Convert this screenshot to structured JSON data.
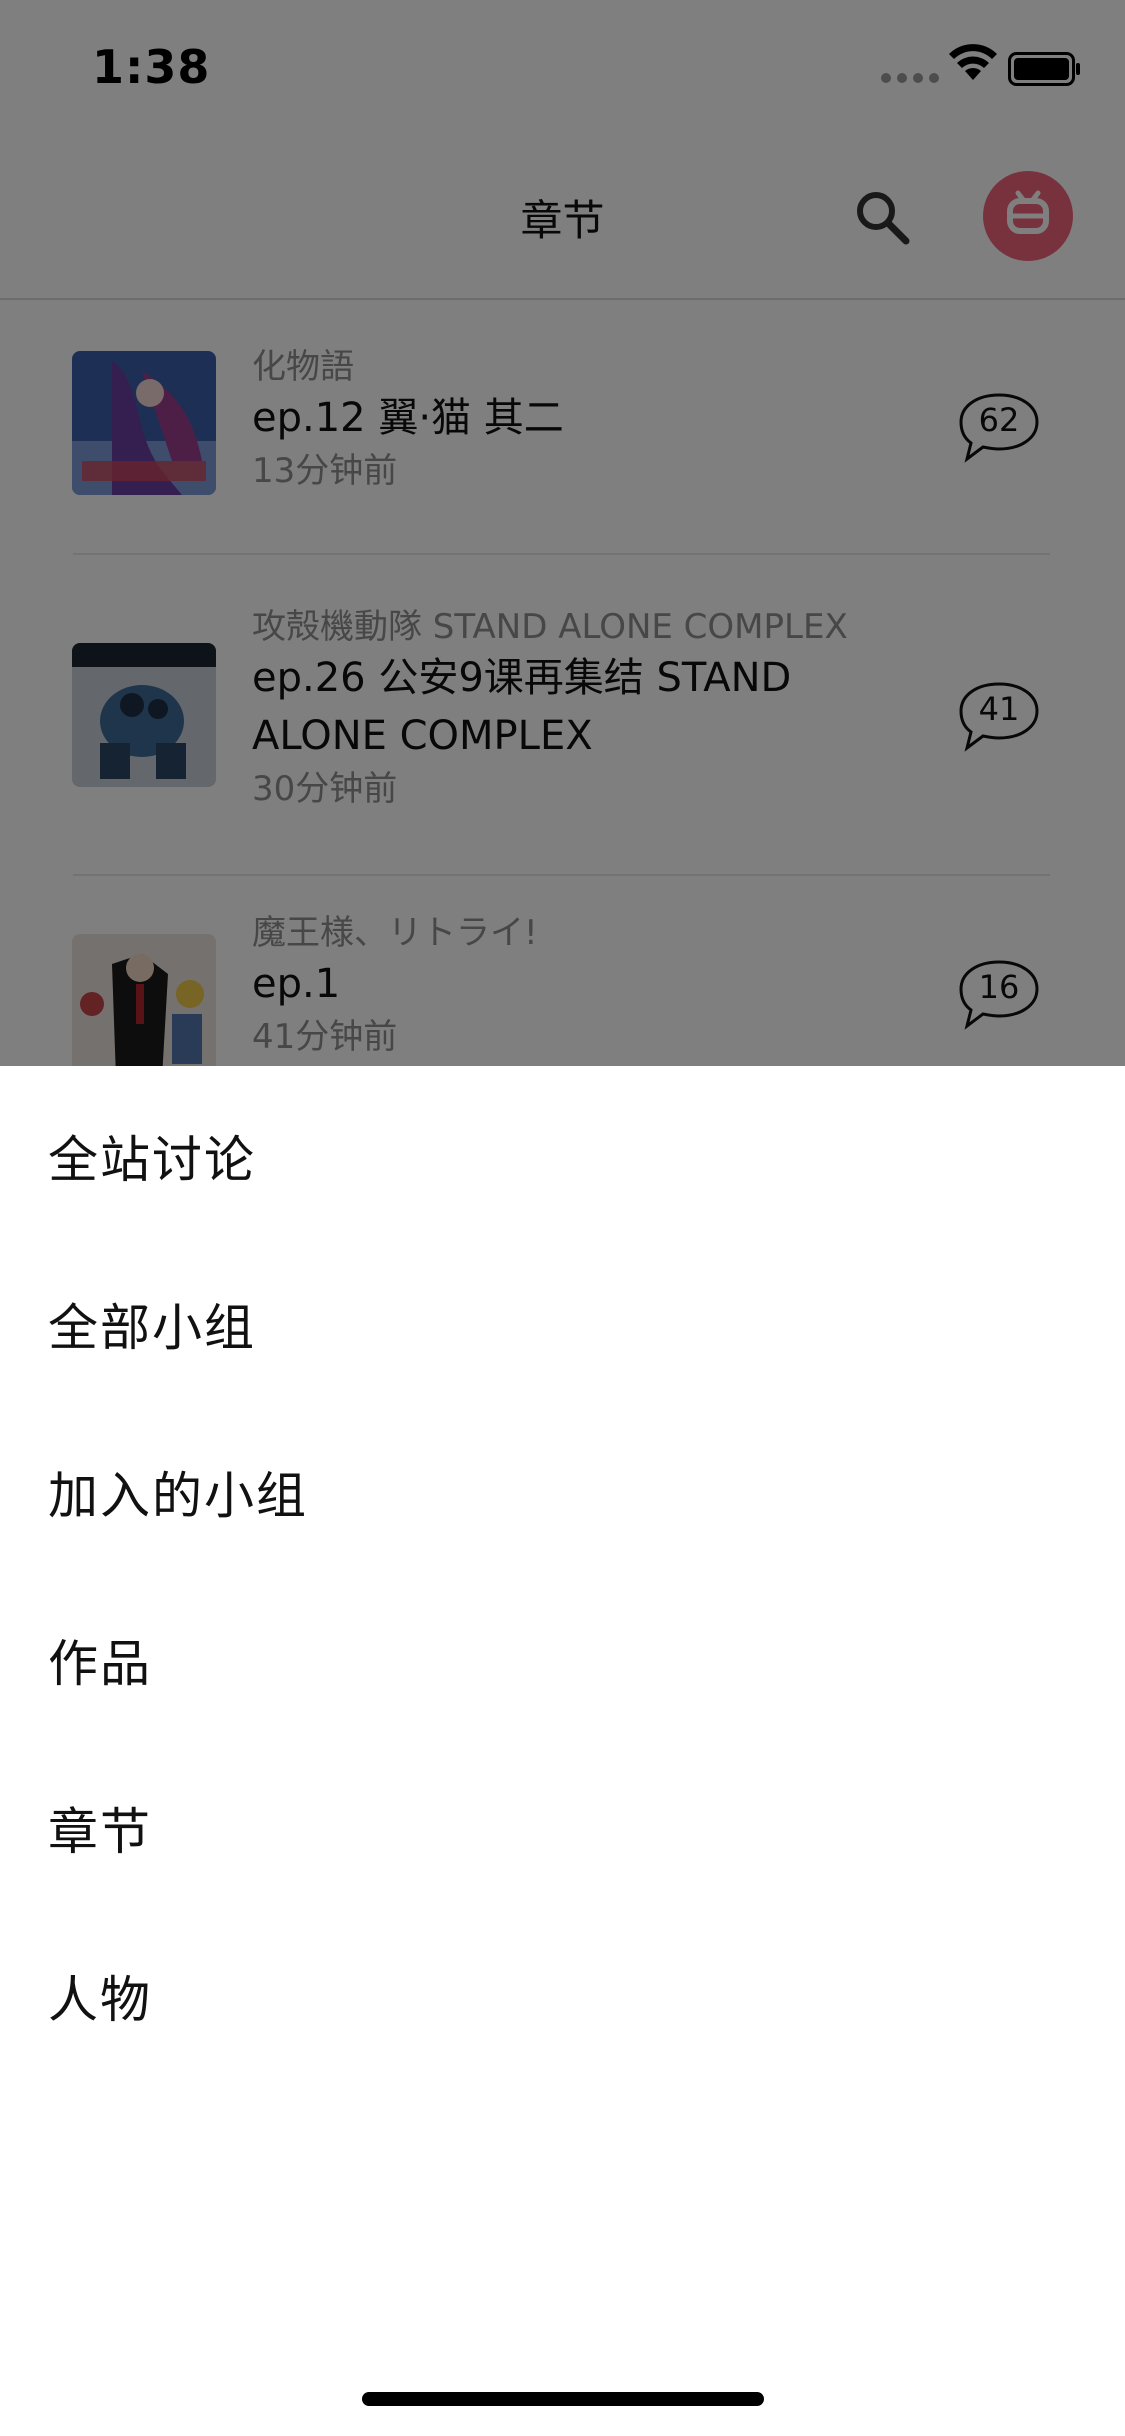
{
  "status_bar": {
    "time": "1:38",
    "icons": [
      "signal-dots-icon",
      "wifi-icon",
      "battery-icon"
    ]
  },
  "nav": {
    "title": "章节",
    "search_icon": "search-icon",
    "avatar_color": "#f0657a"
  },
  "feed": {
    "items": [
      {
        "subject": "化物語",
        "title": "ep.12 翼·猫 其二",
        "time": "13分钟前",
        "comments": "62"
      },
      {
        "subject": "攻殻機動隊 STAND ALONE COMPLEX",
        "title": "ep.26 公安9课再集结 STAND ALONE COMPLEX",
        "time": "30分钟前",
        "comments": "41"
      },
      {
        "subject": "魔王様、リトライ!",
        "title": "ep.1",
        "time": "41分钟前",
        "comments": "16"
      }
    ]
  },
  "sheet": {
    "options": [
      {
        "label": "全站讨论"
      },
      {
        "label": "全部小组"
      },
      {
        "label": "加入的小组"
      },
      {
        "label": "作品"
      },
      {
        "label": "章节"
      },
      {
        "label": "人物"
      }
    ]
  },
  "colors": {
    "scrim": "rgba(0,0,0,0.5)",
    "accent": "#f0657a",
    "text_primary": "#111111",
    "text_secondary": "#8e8e8e"
  }
}
